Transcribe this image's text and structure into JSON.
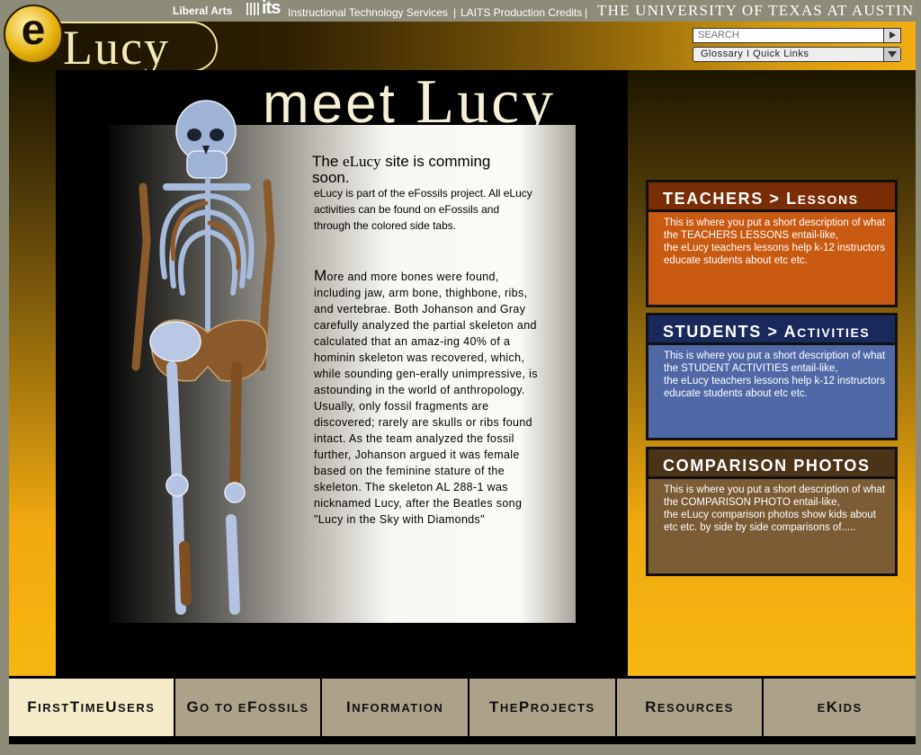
{
  "topbar": {
    "liberal_arts": "Liberal Arts",
    "its": "its",
    "its_text": "Instructional Technology Services",
    "sep1": "|",
    "credits": "LAITS Production Credits",
    "sep2": "|",
    "ut": "THE UNIVERSITY OF TEXAS AT AUSTIN"
  },
  "logo": {
    "e": "e",
    "lucy": "Lucy"
  },
  "search": {
    "placeholder": "SEARCH"
  },
  "glossary": {
    "label": "Glossary I Quick Links"
  },
  "hero": {
    "meet": "meet",
    "lucy": "Lucy"
  },
  "card": {
    "title_pre": "The ",
    "title_brand": "eLucy",
    "title_post": " site is comming soon.",
    "intro": "eLucy is part of the eFossils project. All eLucy activities can be found on eFossils and through the colored side tabs.",
    "body_first": "M",
    "body_rest": "ore and more bones were found, including jaw, arm bone, thighbone, ribs, and vertebrae. Both Johanson and Gray carefully analyzed the partial skeleton and calculated that an amaz-ing 40% of a hominin skeleton was recovered, which, while sounding gen-erally unimpressive, is astounding in the world of anthropology. Usually, only fossil fragments are discovered; rarely are skulls or ribs found intact. As the team analyzed the fossil further, Johanson argued it was female based on the feminine stature of the skeleton. The skeleton AL 288-1 was nicknamed Lucy, after the Beatles song \"Lucy in the Sky with Diamonds\""
  },
  "boxes": {
    "teachers": {
      "heading_a": "TEACHERS > L",
      "heading_b": "ESSONS",
      "body": "This is where you put a short description of what the TEACHERS LESSONS entail-like,\nthe eLucy teachers lessons help k-12 instructors educate students about etc etc."
    },
    "students": {
      "heading_a": "STUDENTS > A",
      "heading_b": "CTIVITIES",
      "body": "This is where you put a short description of what the STUDENT ACTIVITIES entail-like,\nthe eLucy teachers lessons help k-12 instructors educate students about etc etc."
    },
    "comparison": {
      "heading": "COMPARISON PHOTOS",
      "body": "This is where you put a short description of what the COMPARISON PHOTO entail-like,\nthe eLucy comparison photos show kids about etc etc. by side by side comparisons of....."
    }
  },
  "nav": {
    "first_a": "F",
    "first_b": "IRST ",
    "first_c": "T",
    "first_d": "IME ",
    "first_e": "U",
    "first_f": "SERS",
    "efossils_a": "G",
    "efossils_b": "O TO E",
    "efossils_c": "F",
    "efossils_d": "OSSILS",
    "info_a": "I",
    "info_b": "NFORMATION",
    "projects_a": "T",
    "projects_b": "HE ",
    "projects_c": "P",
    "projects_d": "ROJECTS",
    "resources_a": "R",
    "resources_b": "ESOURCES",
    "ekids_a": "E",
    "ekids_b": "K",
    "ekids_c": "IDS"
  },
  "colors": {
    "teachers": "#c95a12",
    "students": "#5069a6",
    "comparison": "#7b5c35",
    "gold": "#f7b611"
  }
}
